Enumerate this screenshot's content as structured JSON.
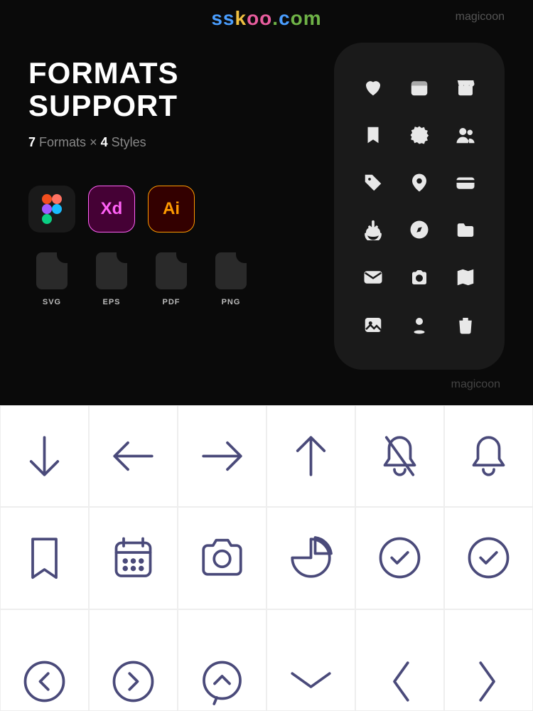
{
  "watermark": "sskoo.com",
  "brand": "magicoon",
  "title_line1": "FORMATS",
  "title_line2": "SUPPORT",
  "subtitle": {
    "count_formats": "7",
    "formats_word": "Formats",
    "sep": "×",
    "count_styles": "4",
    "styles_word": "Styles"
  },
  "apps": {
    "xd": "Xd",
    "ai": "Ai"
  },
  "formats": [
    "SVG",
    "EPS",
    "PDF",
    "PNG"
  ],
  "phone_icons": [
    "heart",
    "calendar",
    "store",
    "bookmark",
    "discount",
    "users",
    "tag",
    "pin",
    "card",
    "download",
    "compass",
    "folder",
    "mail",
    "camera",
    "map",
    "image",
    "location",
    "trash"
  ],
  "grid_icons": [
    "arrow-down",
    "arrow-left",
    "arrow-right",
    "arrow-up",
    "bell-off",
    "bell",
    "bookmark",
    "calendar",
    "camera",
    "pie",
    "check-circle",
    "clock-check",
    "chevron-left-circle",
    "chevron-right-circle",
    "chevron-up-circle",
    "chevron-down-wide",
    "chevron-left-wide",
    "chevron-right-wide"
  ]
}
